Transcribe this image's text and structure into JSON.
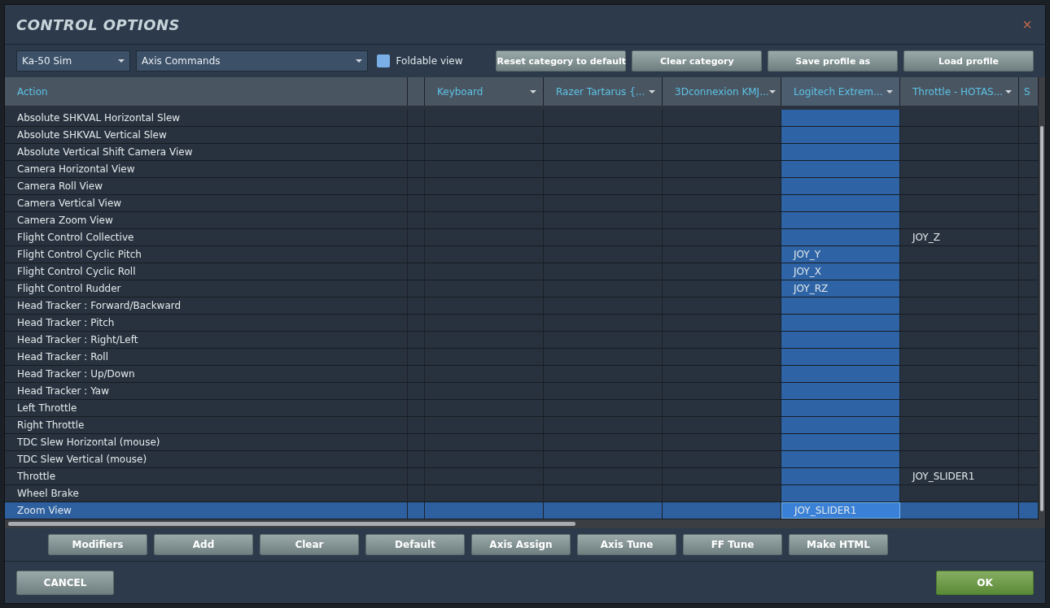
{
  "window": {
    "title": "CONTROL OPTIONS",
    "close": "×"
  },
  "toolbar": {
    "aircraft": "Ka-50 Sim",
    "category": "Axis Commands",
    "foldable_view": {
      "label": "Foldable view",
      "checked": false
    },
    "buttons": [
      "Reset category to default",
      "Clear category",
      "Save profile as",
      "Load profile"
    ]
  },
  "table": {
    "action_column": "Action",
    "columns": [
      {
        "kind": "keyboard",
        "label": "Keyboard",
        "selected": false
      },
      {
        "kind": "razer",
        "label": "Razer Tartarus {...",
        "selected": false
      },
      {
        "kind": "connexion",
        "label": "3Dconnexion KMJ...",
        "selected": false
      },
      {
        "kind": "logitech",
        "label": "Logitech Extrem...",
        "selected": true
      },
      {
        "kind": "throttle",
        "label": "Throttle - HOTAS...",
        "selected": false
      },
      {
        "kind": "cut",
        "label": "S",
        "selected": false
      }
    ],
    "rows": [
      {
        "action": "Absolute SHKVAL Horizontal Slew",
        "selected": false
      },
      {
        "action": "Absolute SHKVAL Vertical Slew",
        "selected": false
      },
      {
        "action": "Absolute Vertical Shift Camera View",
        "selected": false
      },
      {
        "action": "Camera Horizontal View",
        "selected": false
      },
      {
        "action": "Camera Roll View",
        "selected": false
      },
      {
        "action": "Camera Vertical View",
        "selected": false
      },
      {
        "action": "Camera Zoom View",
        "selected": false
      },
      {
        "action": "Flight Control Collective",
        "selected": false,
        "bindings": {
          "throttle": "JOY_Z"
        }
      },
      {
        "action": "Flight Control Cyclic Pitch",
        "selected": false,
        "bindings": {
          "logitech": "JOY_Y"
        }
      },
      {
        "action": "Flight Control Cyclic Roll",
        "selected": false,
        "bindings": {
          "logitech": "JOY_X"
        }
      },
      {
        "action": "Flight Control Rudder",
        "selected": false,
        "bindings": {
          "logitech": "JOY_RZ"
        }
      },
      {
        "action": "Head Tracker : Forward/Backward",
        "selected": false
      },
      {
        "action": "Head Tracker : Pitch",
        "selected": false
      },
      {
        "action": "Head Tracker : Right/Left",
        "selected": false
      },
      {
        "action": "Head Tracker : Roll",
        "selected": false
      },
      {
        "action": "Head Tracker : Up/Down",
        "selected": false
      },
      {
        "action": "Head Tracker : Yaw",
        "selected": false
      },
      {
        "action": "Left Throttle",
        "selected": false
      },
      {
        "action": "Right Throttle",
        "selected": false
      },
      {
        "action": "TDC Slew Horizontal (mouse)",
        "selected": false
      },
      {
        "action": "TDC Slew Vertical (mouse)",
        "selected": false
      },
      {
        "action": "Throttle",
        "selected": false,
        "bindings": {
          "throttle": "JOY_SLIDER1"
        }
      },
      {
        "action": "Wheel Brake",
        "selected": false
      },
      {
        "action": "Zoom View",
        "selected": true,
        "bindings": {
          "logitech": "JOY_SLIDER1"
        }
      }
    ]
  },
  "actions": [
    "Modifiers",
    "Add",
    "Clear",
    "Default",
    "Axis Assign",
    "Axis Tune",
    "FF Tune",
    "Make HTML"
  ],
  "footer": {
    "cancel": "CANCEL",
    "ok": "OK"
  }
}
